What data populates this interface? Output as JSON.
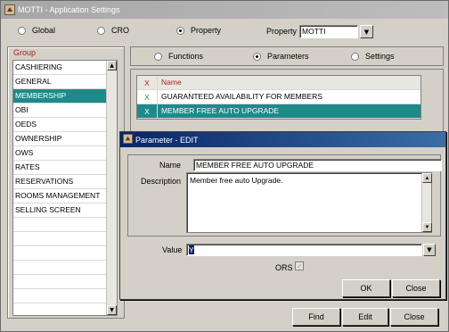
{
  "window": {
    "title": "MOTTI - Application Settings"
  },
  "scope": {
    "options": [
      {
        "label": "Global",
        "selected": false
      },
      {
        "label": "CRO",
        "selected": false
      },
      {
        "label": "Property",
        "selected": true
      }
    ],
    "property_label": "Property",
    "property_value": "MOTTI"
  },
  "group": {
    "title": "Group",
    "items": [
      "CASHIERING",
      "GENERAL",
      "MEMBERSHIP",
      "OBI",
      "OEDS",
      "OWNERSHIP",
      "OWS",
      "RATES",
      "RESERVATIONS",
      "ROOMS MANAGEMENT",
      "SELLING SCREEN"
    ],
    "selected": "MEMBERSHIP"
  },
  "view_tabs": [
    {
      "label": "Functions",
      "selected": false
    },
    {
      "label": "Parameters",
      "selected": true
    },
    {
      "label": "Settings",
      "selected": false
    }
  ],
  "grid": {
    "headers": {
      "x": "X",
      "name": "Name"
    },
    "rows": [
      {
        "x": "X",
        "name": "GUARANTEED AVAILABILITY FOR MEMBERS",
        "selected": false
      },
      {
        "x": "X",
        "name": "MEMBER FREE AUTO UPGRADE",
        "selected": true
      }
    ]
  },
  "buttons": {
    "find": "Find",
    "edit": "Edit",
    "close": "Close"
  },
  "dialog": {
    "title": "Parameter - EDIT",
    "name_label": "Name",
    "name_value": "MEMBER FREE AUTO UPGRADE",
    "description_label": "Description",
    "description_value": "Member free auto Upgrade.",
    "value_label": "Value",
    "value_value": "Y",
    "ors_label": "ORS",
    "ors_checked": true,
    "ok_label": "OK",
    "close_label": "Close"
  },
  "colors": {
    "selection": "#1e8a8a",
    "header_text": "#b02020",
    "dialog_title": "#0a246a"
  }
}
